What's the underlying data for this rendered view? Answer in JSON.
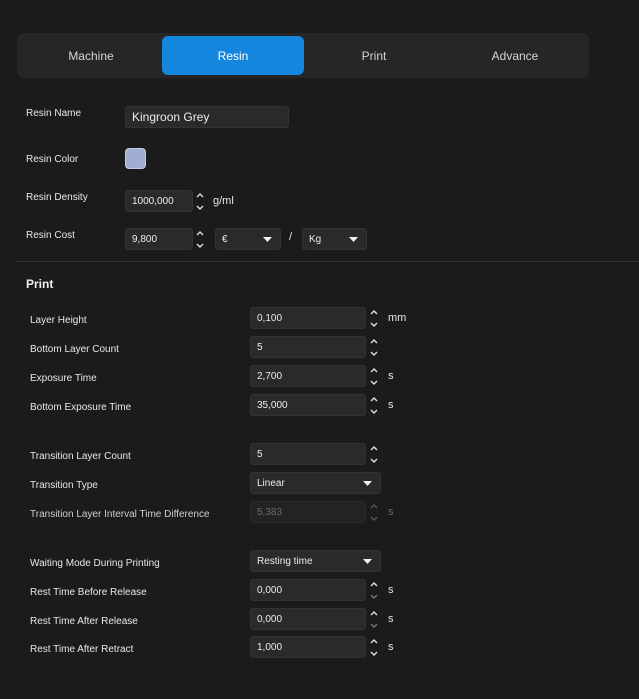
{
  "tabs": [
    "Machine",
    "Resin",
    "Print",
    "Advance"
  ],
  "resin": {
    "name_label": "Resin Name",
    "name_value": "Kingroon Grey",
    "color_label": "Resin Color",
    "color_value": "#a0aed4",
    "density_label": "Resin Density",
    "density_value": "1000,000",
    "density_unit": "g/ml",
    "cost_label": "Resin Cost",
    "cost_value": "9,800",
    "currency": "€",
    "separator": "/",
    "weight_unit": "Kg"
  },
  "print": {
    "section_title": "Print",
    "layer_height_label": "Layer Height",
    "layer_height_value": "0,100",
    "layer_height_unit": "mm",
    "bottom_layer_count_label": "Bottom Layer Count",
    "bottom_layer_count_value": "5",
    "exposure_time_label": "Exposure Time",
    "exposure_time_value": "2,700",
    "exposure_time_unit": "s",
    "bottom_exposure_label": "Bottom Exposure Time",
    "bottom_exposure_value": "35,000",
    "bottom_exposure_unit": "s",
    "transition_count_label": "Transition Layer Count",
    "transition_count_value": "5",
    "transition_type_label": "Transition Type",
    "transition_type_value": "Linear",
    "transition_interval_label": "Transition Layer Interval Time Difference",
    "transition_interval_value": "5,383",
    "transition_interval_unit": "s",
    "waiting_mode_label": "Waiting Mode During Printing",
    "waiting_mode_value": "Resting time",
    "rest_before_label": "Rest Time Before Release",
    "rest_before_value": "0,000",
    "rest_before_unit": "s",
    "rest_after_label": "Rest Time After Release",
    "rest_after_value": "0,000",
    "rest_after_unit": "s",
    "rest_retract_label": "Rest Time After Retract",
    "rest_retract_value": "1,000",
    "rest_retract_unit": "s"
  },
  "colors": {
    "accent": "#1486dd",
    "background": "#1b1b1c",
    "field": "#2a2a2c"
  }
}
